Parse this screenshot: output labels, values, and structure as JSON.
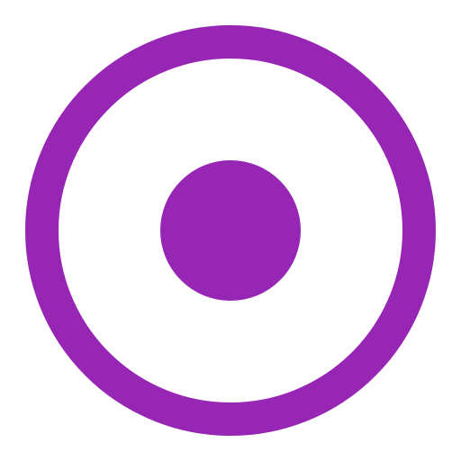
{
  "icon": {
    "name": "radio-button-checked-icon",
    "state": "checked",
    "colors": {
      "accent": "#9726B4",
      "background": "#FFFFFF"
    }
  }
}
